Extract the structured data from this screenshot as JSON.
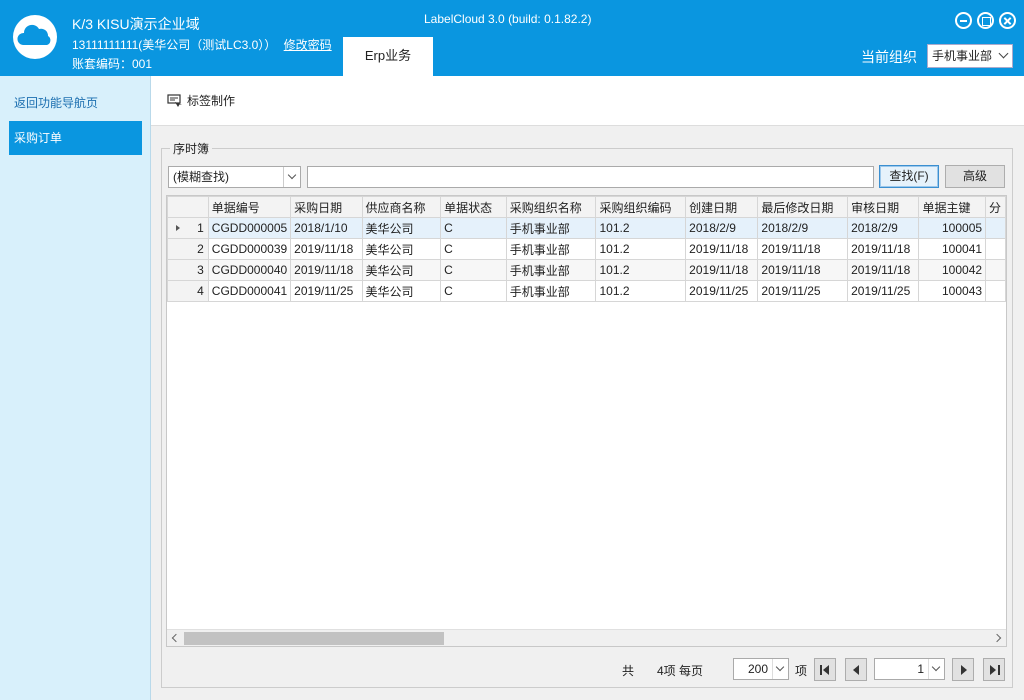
{
  "header": {
    "org_title": "K/3 KISU演示企业域",
    "user_info": "13111111111(美华公司（测试LC3.0））",
    "change_password": "修改密码",
    "account_code": "账套编码：001",
    "app_title": "LabelCloud 3.0 (build: 0.1.82.2)",
    "active_tab": "Erp业务",
    "current_org_label": "当前组织",
    "current_org_value": "手机事业部"
  },
  "sidebar": {
    "back_label": "返回功能导航页",
    "items": [
      {
        "label": "采购订单",
        "active": true
      }
    ]
  },
  "toolbar": {
    "label_make": "标签制作"
  },
  "panel": {
    "title": "序时簿",
    "search_mode": "(模糊查找)",
    "search_value": "",
    "find_label": "查找(F)",
    "advanced_label": "高级"
  },
  "grid": {
    "columns": [
      "单据编号",
      "采购日期",
      "供应商名称",
      "单据状态",
      "采购组织名称",
      "采购组织编码",
      "创建日期",
      "最后修改日期",
      "审核日期",
      "单据主键",
      "分"
    ],
    "rows": [
      {
        "index": "1",
        "cells": [
          "CGDD000005",
          "2018/1/10",
          "美华公司",
          "C",
          "手机事业部",
          "101.2",
          "2018/2/9",
          "2018/2/9",
          "2018/2/9",
          "100005",
          ""
        ]
      },
      {
        "index": "2",
        "cells": [
          "CGDD000039",
          "2019/11/18",
          "美华公司",
          "C",
          "手机事业部",
          "101.2",
          "2019/11/18",
          "2019/11/18",
          "2019/11/18",
          "100041",
          ""
        ]
      },
      {
        "index": "3",
        "cells": [
          "CGDD000040",
          "2019/11/18",
          "美华公司",
          "C",
          "手机事业部",
          "101.2",
          "2019/11/18",
          "2019/11/18",
          "2019/11/18",
          "100042",
          ""
        ]
      },
      {
        "index": "4",
        "cells": [
          "CGDD000041",
          "2019/11/25",
          "美华公司",
          "C",
          "手机事业部",
          "101.2",
          "2019/11/25",
          "2019/11/25",
          "2019/11/25",
          "100043",
          ""
        ]
      }
    ]
  },
  "pager": {
    "total_prefix": "共",
    "total_count": "4项 每页",
    "page_size": "200",
    "items_suffix": "项",
    "current_page": "1"
  },
  "colors": {
    "accent": "#0a96e0",
    "sidebar_bg": "#d8f0fb",
    "selected_row": "#e5f1fb"
  },
  "icons": [
    "cloud-logo-icon",
    "minimize-icon",
    "maximize-icon",
    "close-icon",
    "label-print-icon"
  ]
}
